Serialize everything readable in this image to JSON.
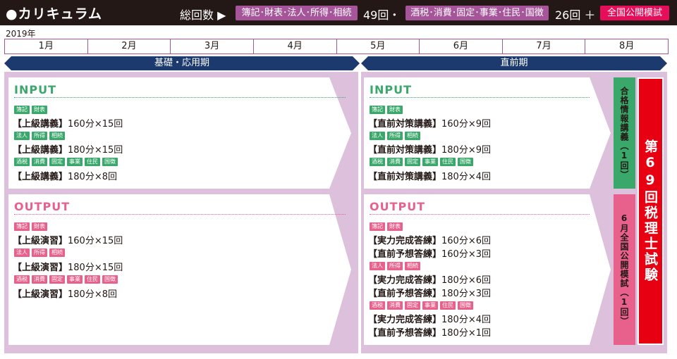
{
  "header": {
    "title": "●カリキュラム",
    "total_label": "総回数 ▶",
    "pill1": "簿記･財表･法人･所得･相続",
    "count1": "49回・",
    "pill2": "酒税･消費･固定･事業･住民･国徴",
    "count2": "26回 ＋",
    "pill3": "全国公開模試"
  },
  "year": "2019年",
  "months": [
    "1月",
    "2月",
    "3月",
    "4月",
    "5月",
    "6月",
    "7月",
    "8月"
  ],
  "phases": {
    "basic": "基礎・応用期",
    "final": "直前期"
  },
  "colors": {
    "green": "#3aa86b",
    "pink": "#e8618c",
    "red": "#e60012",
    "navy": "#1d3a6e",
    "panel": "#dcc0dc"
  },
  "left": {
    "input": {
      "heading": "INPUT",
      "tags1": [
        "簿記",
        "財表"
      ],
      "line1_name": "【上級講義】",
      "line1_detail": "160分×15回",
      "tags2": [
        "法人",
        "所得",
        "相続"
      ],
      "line2_name": "【上級講義】",
      "line2_detail": "180分×15回",
      "tags3": [
        "酒税",
        "消費",
        "固定",
        "事業",
        "住民",
        "国徴"
      ],
      "line3_name": "【上級講義】",
      "line3_detail": "180分×8回"
    },
    "output": {
      "heading": "OUTPUT",
      "tags1": [
        "簿記",
        "財表"
      ],
      "line1_name": "【上級演習】",
      "line1_detail": "160分×15回",
      "tags2": [
        "法人",
        "所得",
        "相続"
      ],
      "line2_name": "【上級演習】",
      "line2_detail": "180分×15回",
      "tags3": [
        "酒税",
        "消費",
        "固定",
        "事業",
        "住民",
        "国徴"
      ],
      "line3_name": "【上級演習】",
      "line3_detail": "180分×8回"
    }
  },
  "right": {
    "input": {
      "heading": "INPUT",
      "tags1": [
        "簿記",
        "財表"
      ],
      "line1_name": "【直前対策講義】",
      "line1_detail": "160分×9回",
      "tags2": [
        "法人",
        "所得",
        "相続"
      ],
      "line2_name": "【直前対策講義】",
      "line2_detail": "180分×9回",
      "tags3": [
        "酒税",
        "消費",
        "固定",
        "事業",
        "住民",
        "国徴"
      ],
      "line3_name": "【直前対策講義】",
      "line3_detail": "180分×4回"
    },
    "output": {
      "heading": "OUTPUT",
      "tags1": [
        "簿記",
        "財表"
      ],
      "line1_name": "【実力完成答練】",
      "line1_detail": "160分×6回",
      "line2_name": "【直前予想答練】",
      "line2_detail": "160分×3回",
      "tags2": [
        "法人",
        "所得",
        "相続"
      ],
      "line3_name": "【実力完成答練】",
      "line3_detail": "180分×6回",
      "line4_name": "【直前予想答練】",
      "line4_detail": "180分×3回",
      "tags3": [
        "酒税",
        "消費",
        "固定",
        "事業",
        "住民",
        "国徴"
      ],
      "line5_name": "【実力完成答練】",
      "line5_detail": "180分×4回",
      "line6_name": "【直前予想答練】",
      "line6_detail": "180分×1回"
    }
  },
  "side": {
    "info_session": "合格情報講義（1回）",
    "mock_exam": "6月全国公開模試（1回）",
    "exam": "第69回税理士試験"
  }
}
